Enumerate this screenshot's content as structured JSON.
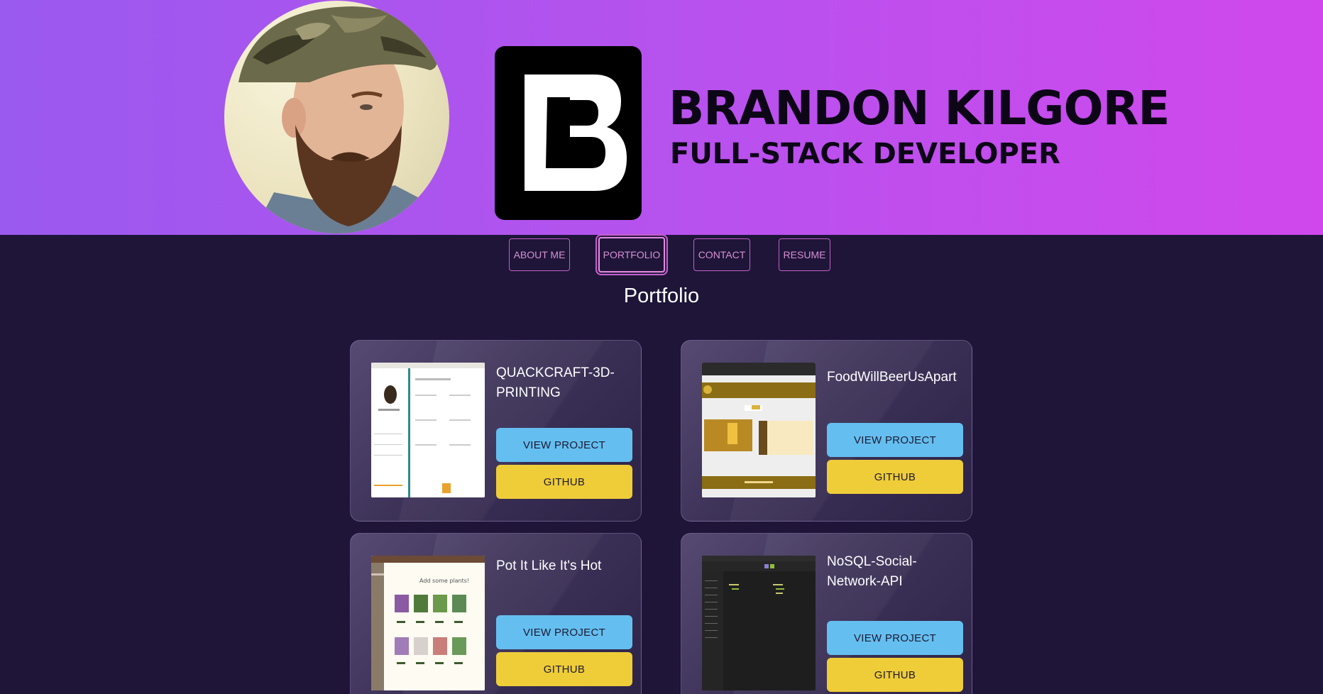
{
  "header": {
    "name": "BRANDON KILGORE",
    "role": "FULL-STACK DEVELOPER",
    "logo_letter": "B"
  },
  "nav": {
    "items": [
      {
        "label": "ABOUT ME"
      },
      {
        "label": "PORTFOLIO"
      },
      {
        "label": "CONTACT"
      },
      {
        "label": "RESUME"
      }
    ],
    "active": "PORTFOLIO"
  },
  "section_title": "Portfolio",
  "projects": [
    {
      "title": "QUACKCRAFT-3D-PRINTING",
      "view_label": "VIEW PROJECT",
      "github_label": "GITHUB"
    },
    {
      "title": "FoodWillBeerUsApart",
      "view_label": "VIEW PROJECT",
      "github_label": "GITHUB"
    },
    {
      "title": "Pot It Like It's Hot",
      "view_label": "VIEW PROJECT",
      "github_label": "GITHUB"
    },
    {
      "title": "NoSQL-Social-Network-API",
      "view_label": "VIEW PROJECT",
      "github_label": "GITHUB"
    }
  ],
  "thumb_text": {
    "pot_heading": "Add some plants!"
  },
  "colors": {
    "header_start": "#9a59ef",
    "header_end": "#d048ec",
    "page_bg": "#1e1538",
    "nav_accent": "#c55ec7",
    "view_button": "#64bff0",
    "github_button": "#eecd39"
  }
}
